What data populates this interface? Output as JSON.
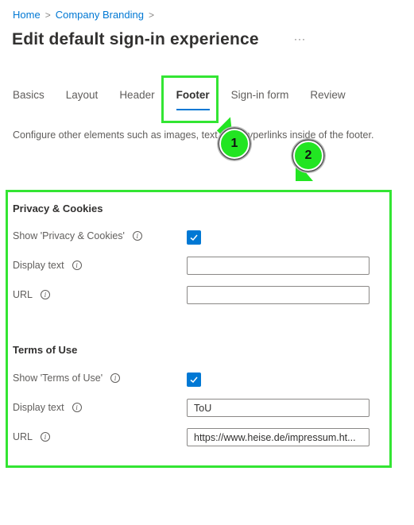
{
  "breadcrumb": {
    "items": [
      "Home",
      "Company Branding"
    ],
    "separator": ">"
  },
  "page": {
    "title": "Edit default sign-in experience",
    "more_label": "···"
  },
  "tabs": [
    {
      "label": "Basics",
      "active": false
    },
    {
      "label": "Layout",
      "active": false
    },
    {
      "label": "Header",
      "active": false
    },
    {
      "label": "Footer",
      "active": true
    },
    {
      "label": "Sign-in form",
      "active": false
    },
    {
      "label": "Review",
      "active": false
    }
  ],
  "description": "Configure other elements such as images, text, and hyperlinks inside of the footer.",
  "annotations": {
    "markers": [
      "1",
      "2"
    ],
    "highlight_color": "#33e533"
  },
  "privacy": {
    "title": "Privacy & Cookies",
    "show_label": "Show 'Privacy & Cookies'",
    "show_checked": true,
    "display_text_label": "Display text",
    "display_text_value": "",
    "url_label": "URL",
    "url_value": ""
  },
  "terms": {
    "title": "Terms of Use",
    "show_label": "Show 'Terms of Use'",
    "show_checked": true,
    "display_text_label": "Display text",
    "display_text_value": "ToU",
    "url_label": "URL",
    "url_value": "https://www.heise.de/impressum.ht..."
  },
  "icons": {
    "info": "i",
    "chevron": ">"
  },
  "colors": {
    "accent": "#0078d4",
    "annotation": "#22e522"
  }
}
